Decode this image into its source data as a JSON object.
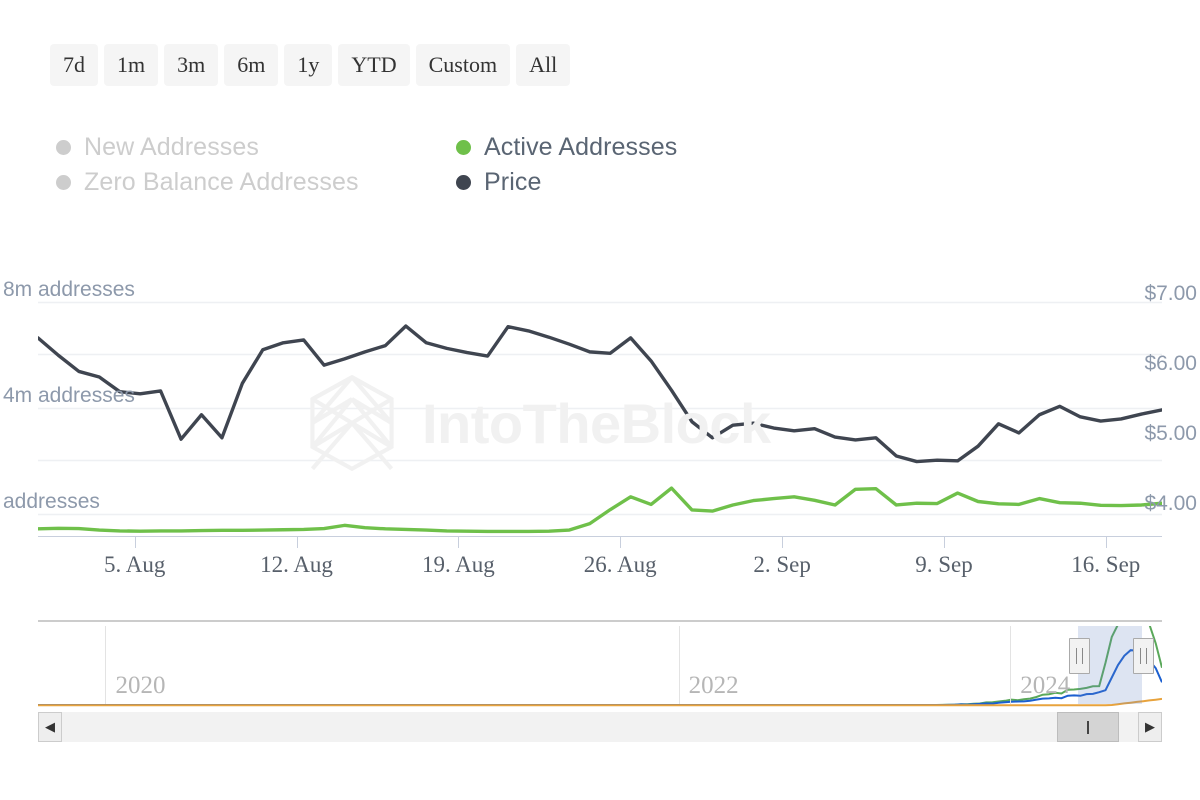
{
  "range_selector": {
    "buttons": [
      {
        "label": "7d",
        "selected": false
      },
      {
        "label": "1m",
        "selected": false
      },
      {
        "label": "3m",
        "selected": false
      },
      {
        "label": "6m",
        "selected": false
      },
      {
        "label": "1y",
        "selected": false
      },
      {
        "label": "YTD",
        "selected": false
      },
      {
        "label": "Custom",
        "selected": false
      },
      {
        "label": "All",
        "selected": false
      }
    ]
  },
  "legend": {
    "items": [
      {
        "label": "New Addresses",
        "color": "#cdcdcd",
        "active": false
      },
      {
        "label": "Active Addresses",
        "color": "#6fc04a",
        "active": true
      },
      {
        "label": "Zero Balance Addresses",
        "color": "#cdcdcd",
        "active": false
      },
      {
        "label": "Price",
        "color": "#3f4550",
        "active": true
      }
    ]
  },
  "watermark": {
    "text": "IntoTheBlock",
    "logo_icon": "intotheblock-hexagon-logo"
  },
  "navigator": {
    "year_labels": [
      "2020",
      "2022",
      "2024"
    ],
    "selection": {
      "start_pct": 92.5,
      "end_pct": 98.2
    },
    "series_colors": {
      "green": "#5aa85a",
      "blue": "#1b5fd0",
      "orange": "#e8a33d"
    },
    "scrollbar": {
      "left_arrow_icon": "chevron-left-icon",
      "right_arrow_icon": "chevron-right-icon",
      "thumb_grip_icon": "grip-lines-icon",
      "thumb_start_pct": 92.5,
      "thumb_end_pct": 98.2
    }
  },
  "chart_data": {
    "type": "line",
    "title": "",
    "xlabel": "",
    "ylabel": "addresses",
    "grid": true,
    "legend_position": "top-left",
    "x_tick_labels": [
      "5. Aug",
      "12. Aug",
      "19. Aug",
      "26. Aug",
      "2. Sep",
      "9. Sep",
      "16. Sep"
    ],
    "x_tick_positions_pct": [
      8.6,
      23.0,
      37.4,
      51.8,
      66.2,
      80.6,
      95.0
    ],
    "left_axis": {
      "label_suffix": "addresses",
      "tick_labels": [
        "8m addresses",
        "4m addresses",
        "addresses"
      ],
      "tick_values": [
        8000000,
        4000000,
        0
      ],
      "ylim": [
        0,
        9000000
      ],
      "gridlines_pct": [
        7.5,
        48.0,
        88.5
      ]
    },
    "right_axis": {
      "tick_labels": [
        "$7.00",
        "$6.00",
        "$5.00",
        "$4.00"
      ],
      "tick_values": [
        7.0,
        6.0,
        5.0,
        4.0
      ],
      "ylim": [
        3.6,
        7.35
      ]
    },
    "series": [
      {
        "name": "Price",
        "color": "#3f4550",
        "axis": "right",
        "unit": "USD",
        "values": [
          6.55,
          6.3,
          6.07,
          5.99,
          5.78,
          5.75,
          5.79,
          5.1,
          5.45,
          5.12,
          5.9,
          6.38,
          6.48,
          6.52,
          6.16,
          6.25,
          6.35,
          6.44,
          6.72,
          6.48,
          6.4,
          6.34,
          6.29,
          6.71,
          6.65,
          6.56,
          6.46,
          6.35,
          6.33,
          6.55,
          6.22,
          5.8,
          5.35,
          5.12,
          5.3,
          5.33,
          5.26,
          5.22,
          5.25,
          5.13,
          5.09,
          5.12,
          4.86,
          4.78,
          4.8,
          4.79,
          5.0,
          5.32,
          5.19,
          5.45,
          5.57,
          5.42,
          5.36,
          5.39,
          5.46,
          5.52
        ]
      },
      {
        "name": "Active Addresses",
        "color": "#6fc04a",
        "axis": "left",
        "unit": "addresses",
        "values": [
          520000,
          540000,
          530000,
          480000,
          450000,
          440000,
          450000,
          450000,
          460000,
          470000,
          470000,
          480000,
          490000,
          500000,
          530000,
          640000,
          560000,
          520000,
          500000,
          480000,
          450000,
          440000,
          430000,
          430000,
          430000,
          440000,
          480000,
          700000,
          1180000,
          1620000,
          1360000,
          1920000,
          1170000,
          1130000,
          1340000,
          1490000,
          1560000,
          1620000,
          1500000,
          1340000,
          1880000,
          1900000,
          1340000,
          1400000,
          1390000,
          1750000,
          1460000,
          1380000,
          1360000,
          1560000,
          1420000,
          1400000,
          1330000,
          1320000,
          1340000,
          1400000
        ]
      }
    ]
  }
}
